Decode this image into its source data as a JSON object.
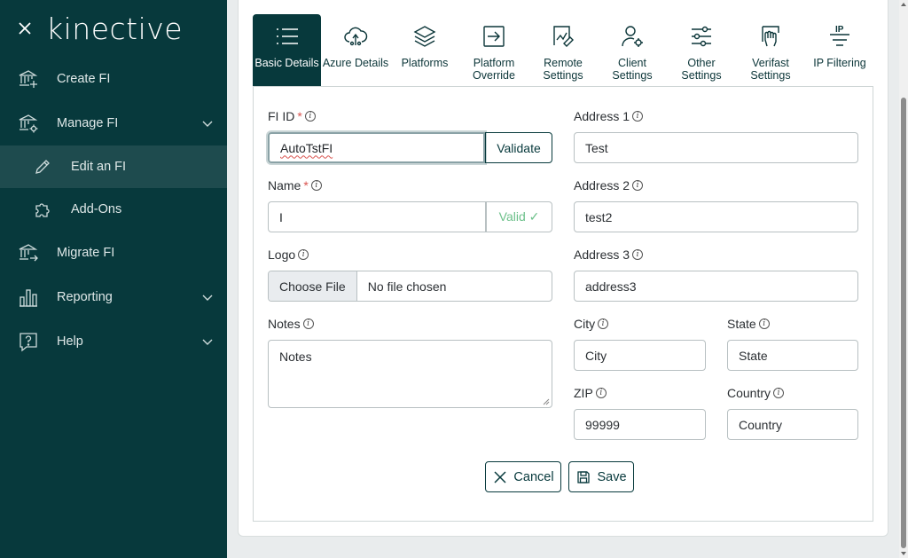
{
  "sidebar": {
    "brand": "kinective",
    "items": [
      {
        "label": "Create FI",
        "icon": "bank-plus-icon"
      },
      {
        "label": "Manage FI",
        "icon": "bank-gear-icon",
        "expandable": true
      },
      {
        "label": "Edit an FI",
        "icon": "pencil-icon",
        "sub": true,
        "active": true
      },
      {
        "label": "Add-Ons",
        "icon": "puzzle-icon",
        "sub": true
      },
      {
        "label": "Migrate FI",
        "icon": "bank-arrow-icon"
      },
      {
        "label": "Reporting",
        "icon": "bar-chart-icon",
        "expandable": true
      },
      {
        "label": "Help",
        "icon": "help-icon",
        "expandable": true
      }
    ]
  },
  "tabs": [
    {
      "label": "Basic Details",
      "icon": "list-icon",
      "active": true
    },
    {
      "label": "Azure Details",
      "icon": "cloud-icon"
    },
    {
      "label": "Platforms",
      "icon": "layers-icon"
    },
    {
      "label": "Platform Override",
      "icon": "override-icon"
    },
    {
      "label": "Remote Settings",
      "icon": "remote-icon"
    },
    {
      "label": "Client Settings",
      "icon": "user-gear-icon"
    },
    {
      "label": "Other Settings",
      "icon": "sliders-icon"
    },
    {
      "label": "Verifast Settings",
      "icon": "hand-icon"
    },
    {
      "label": "IP Filtering",
      "icon": "ip-filter-icon"
    }
  ],
  "form": {
    "fi_id": {
      "label": "FI ID",
      "required": "*",
      "value": "AutoTstFI",
      "button": "Validate"
    },
    "name": {
      "label": "Name",
      "required": "*",
      "value": "I",
      "status": "Valid ✓"
    },
    "logo": {
      "label": "Logo",
      "button": "Choose File",
      "status": "No file chosen"
    },
    "notes": {
      "label": "Notes",
      "placeholder": "Notes"
    },
    "address1": {
      "label": "Address 1",
      "value": "Test"
    },
    "address2": {
      "label": "Address 2",
      "value": "test2"
    },
    "address3": {
      "label": "Address 3",
      "value": "address3"
    },
    "city": {
      "label": "City",
      "placeholder": "City"
    },
    "state": {
      "label": "State",
      "placeholder": "State"
    },
    "zip": {
      "label": "ZIP",
      "value": "99999"
    },
    "country": {
      "label": "Country",
      "placeholder": "Country"
    }
  },
  "actions": {
    "cancel": "Cancel",
    "save": "Save"
  },
  "colors": {
    "sidebar": "#07393c",
    "accent": "#07393c",
    "valid": "#6cc08a",
    "required": "#d9534f"
  }
}
